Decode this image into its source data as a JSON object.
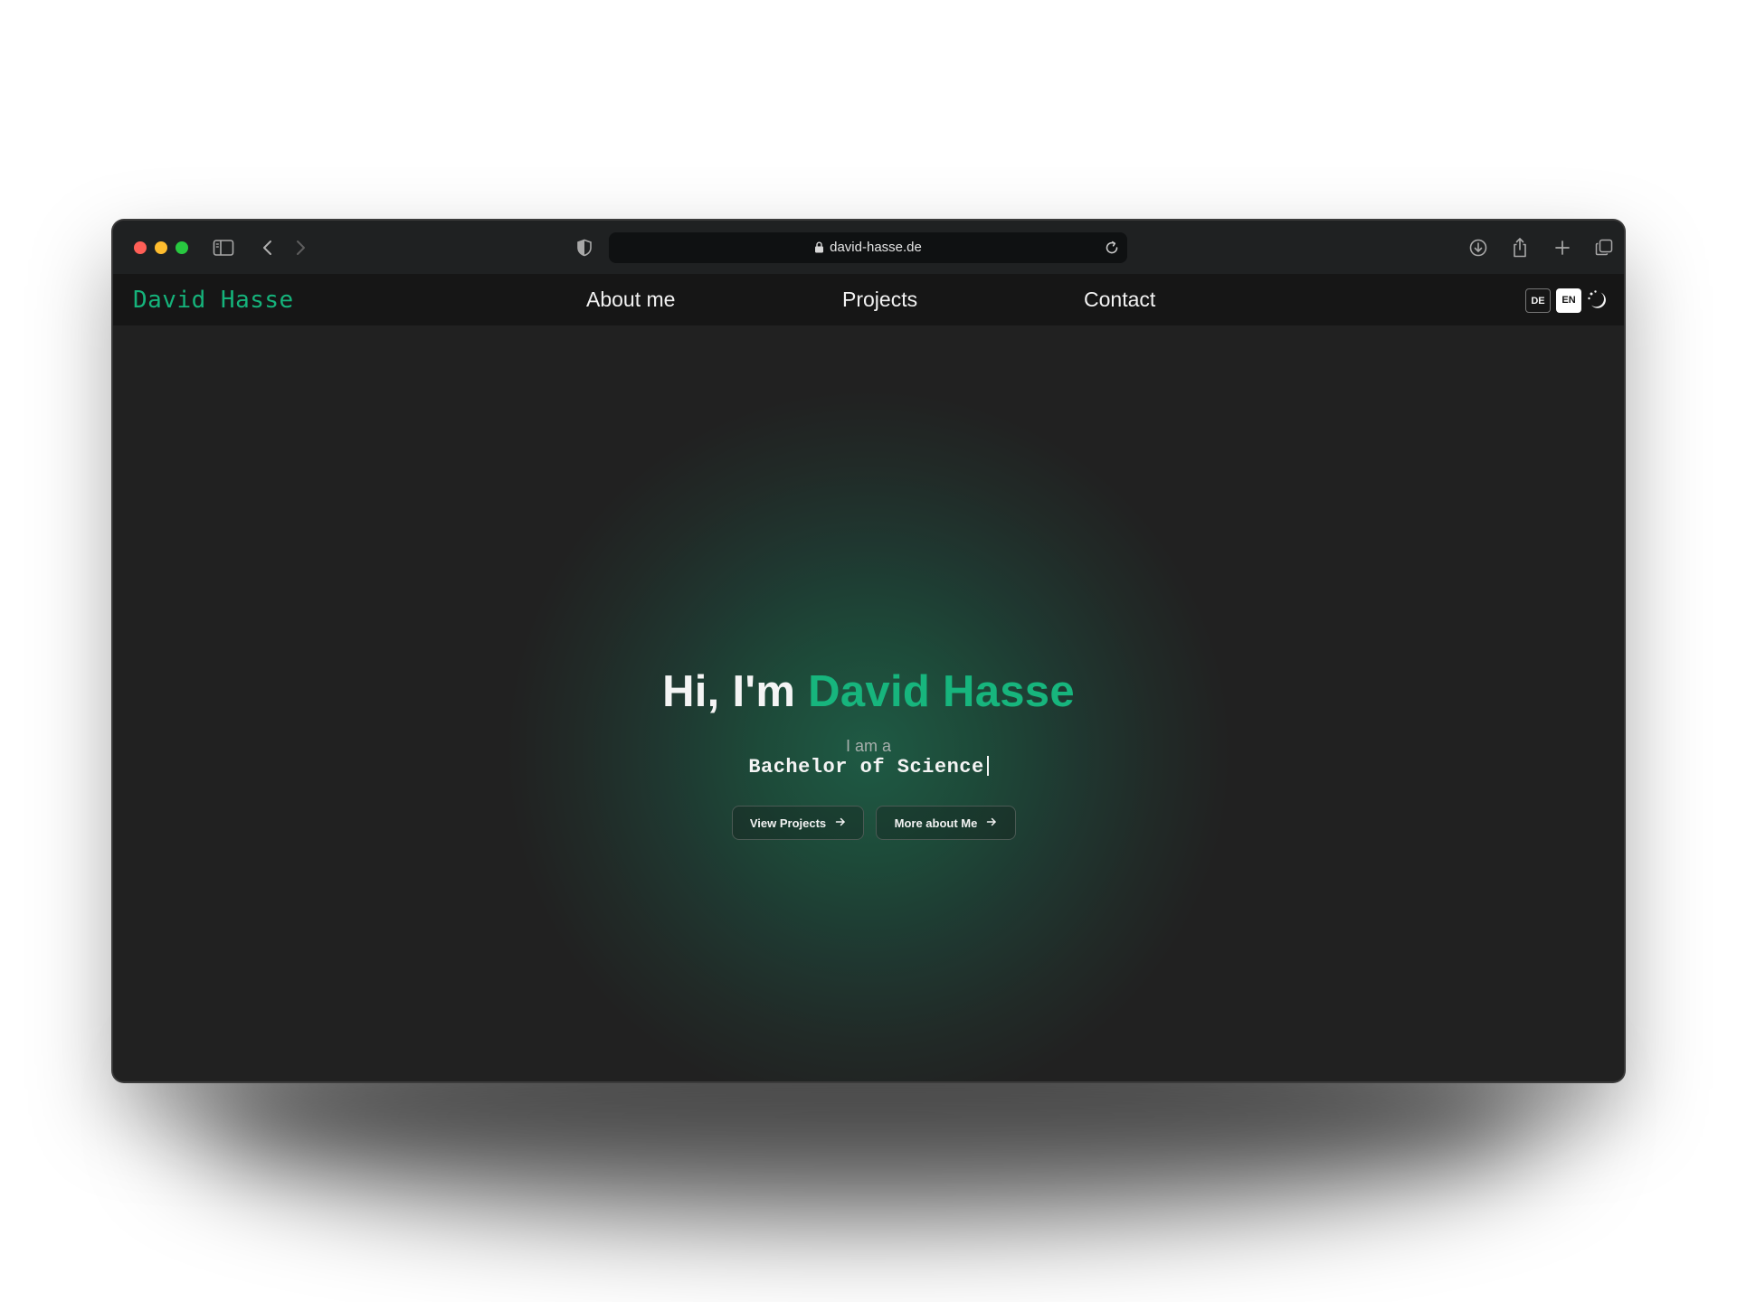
{
  "browser": {
    "url": "david-hasse.de"
  },
  "site": {
    "logo": "David Hasse",
    "nav": {
      "about": "About me",
      "projects": "Projects",
      "contact": "Contact"
    },
    "languages": {
      "de": "DE",
      "en": "EN",
      "active": "EN"
    }
  },
  "hero": {
    "greeting": "Hi, I'm ",
    "name": "David Hasse",
    "intro": "I am a",
    "role": "Bachelor of Science",
    "buttons": {
      "projects": "View Projects",
      "about": "More about Me"
    }
  },
  "colors": {
    "accent": "#17b57d",
    "background": "#212121",
    "nav_background": "#161616",
    "toolbar": "#1f2122"
  },
  "icons": {
    "toolbar": [
      "sidebar-icon",
      "back-icon",
      "forward-icon",
      "shield-icon",
      "lock-icon",
      "reload-icon",
      "download-icon",
      "share-icon",
      "new-tab-icon",
      "tabs-overview-icon"
    ],
    "site": [
      "theme-toggle-icon",
      "arrow-right-icon"
    ]
  }
}
